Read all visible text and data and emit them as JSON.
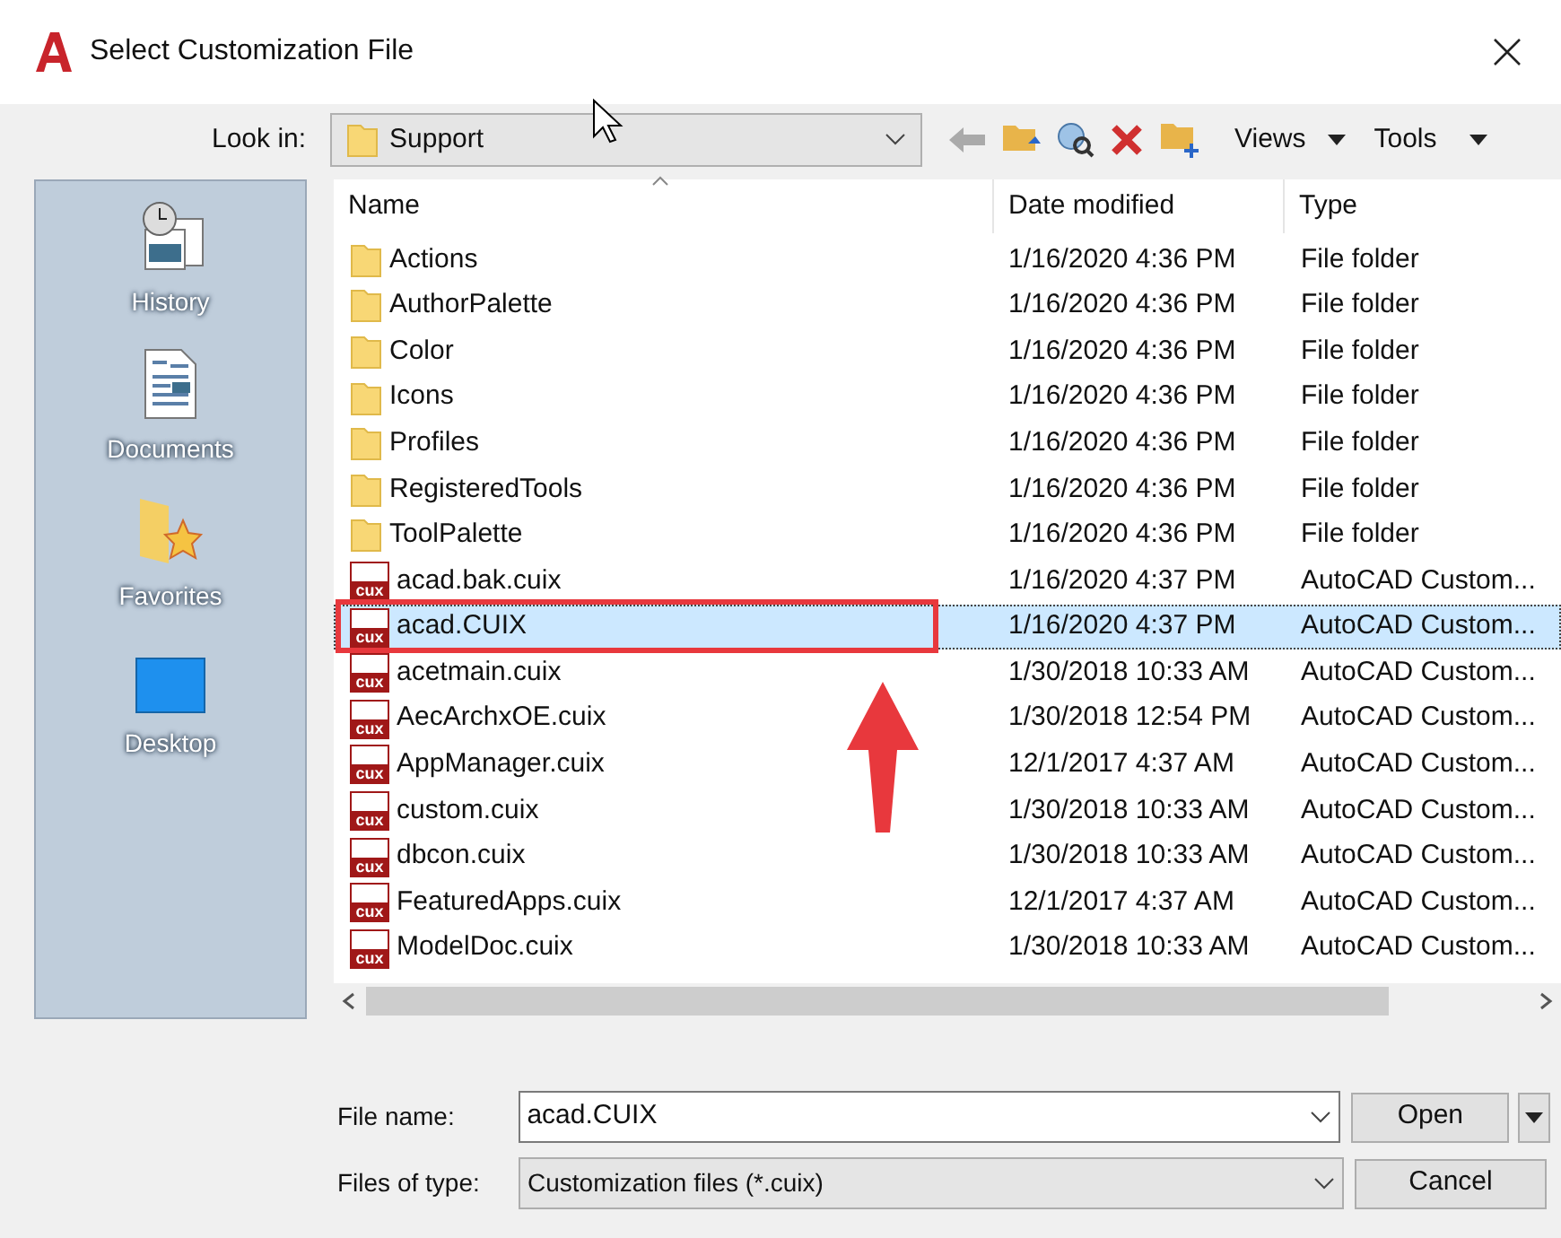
{
  "window": {
    "title": "Select Customization File"
  },
  "toolbar": {
    "look_in_label": "Look in:",
    "look_in_value": "Support",
    "views": "Views",
    "tools": "Tools"
  },
  "places": [
    {
      "label": "History",
      "kind": "history"
    },
    {
      "label": "Documents",
      "kind": "documents"
    },
    {
      "label": "Favorites",
      "kind": "favorites"
    },
    {
      "label": "Desktop",
      "kind": "desktop"
    }
  ],
  "table": {
    "columns": [
      "Name",
      "Date modified",
      "Type"
    ],
    "rows": [
      {
        "kind": "folder",
        "name": "Actions",
        "date": "1/16/2020 4:36 PM",
        "type": "File folder",
        "selected": false
      },
      {
        "kind": "folder",
        "name": "AuthorPalette",
        "date": "1/16/2020 4:36 PM",
        "type": "File folder",
        "selected": false
      },
      {
        "kind": "folder",
        "name": "Color",
        "date": "1/16/2020 4:36 PM",
        "type": "File folder",
        "selected": false
      },
      {
        "kind": "folder",
        "name": "Icons",
        "date": "1/16/2020 4:36 PM",
        "type": "File folder",
        "selected": false
      },
      {
        "kind": "folder",
        "name": "Profiles",
        "date": "1/16/2020 4:36 PM",
        "type": "File folder",
        "selected": false
      },
      {
        "kind": "folder",
        "name": "RegisteredTools",
        "date": "1/16/2020 4:36 PM",
        "type": "File folder",
        "selected": false
      },
      {
        "kind": "folder",
        "name": "ToolPalette",
        "date": "1/16/2020 4:36 PM",
        "type": "File folder",
        "selected": false
      },
      {
        "kind": "cuix",
        "name": "acad.bak.cuix",
        "icon_text": "cux",
        "date": "1/16/2020 4:37 PM",
        "type": "AutoCAD Custom...",
        "selected": false
      },
      {
        "kind": "cuix",
        "name": "acad.CUIX",
        "icon_text": "cux",
        "date": "1/16/2020 4:37 PM",
        "type": "AutoCAD Custom...",
        "selected": true
      },
      {
        "kind": "cuix",
        "name": "acetmain.cuix",
        "icon_text": "cux",
        "date": "1/30/2018 10:33 AM",
        "type": "AutoCAD Custom...",
        "selected": false
      },
      {
        "kind": "cuix",
        "name": "AecArchxOE.cuix",
        "icon_text": "cux",
        "date": "1/30/2018 12:54 PM",
        "type": "AutoCAD Custom...",
        "selected": false
      },
      {
        "kind": "cuix",
        "name": "AppManager.cuix",
        "icon_text": "cux",
        "date": "12/1/2017 4:37 AM",
        "type": "AutoCAD Custom...",
        "selected": false
      },
      {
        "kind": "cuix",
        "name": "custom.cuix",
        "icon_text": "cux",
        "date": "1/30/2018 10:33 AM",
        "type": "AutoCAD Custom...",
        "selected": false
      },
      {
        "kind": "cuix",
        "name": "dbcon.cuix",
        "icon_text": "cux",
        "date": "1/30/2018 10:33 AM",
        "type": "AutoCAD Custom...",
        "selected": false
      },
      {
        "kind": "cuix",
        "name": "FeaturedApps.cuix",
        "icon_text": "cux",
        "date": "12/1/2017 4:37 AM",
        "type": "AutoCAD Custom...",
        "selected": false
      },
      {
        "kind": "cuix",
        "name": "ModelDoc.cuix",
        "icon_text": "cux",
        "date": "1/30/2018 10:33 AM",
        "type": "AutoCAD Custom...",
        "selected": false
      }
    ]
  },
  "file_name": {
    "label": "File name:",
    "value": "acad.CUIX"
  },
  "file_type": {
    "label": "Files of type:",
    "value": "Customization files (*.cuix)"
  },
  "buttons": {
    "open": "Open",
    "cancel": "Cancel"
  }
}
